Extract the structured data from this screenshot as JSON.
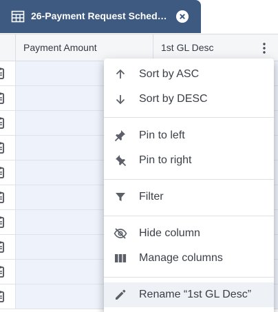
{
  "tab": {
    "title": "26-Payment Request Sched…",
    "icon": "table-icon",
    "close_icon": "close-circle-icon",
    "color": "#3e5a80"
  },
  "grid": {
    "columns": [
      "Payment Amount",
      "1st GL Desc"
    ],
    "row_icon": "clipboard-icon",
    "menu_icon": "more-vertical-icon"
  },
  "column_menu": {
    "items": [
      {
        "label": "Sort by ASC",
        "icon": "arrow-up-icon"
      },
      {
        "label": "Sort by DESC",
        "icon": "arrow-down-icon"
      },
      {
        "label": "Pin to left",
        "icon": "pin-left-icon"
      },
      {
        "label": "Pin to right",
        "icon": "pin-right-icon"
      },
      {
        "label": "Filter",
        "icon": "filter-icon"
      },
      {
        "label": "Hide column",
        "icon": "eye-off-icon"
      },
      {
        "label": "Manage columns",
        "icon": "columns-icon"
      },
      {
        "label": "Rename “1st GL Desc”",
        "icon": "pencil-icon"
      }
    ]
  }
}
